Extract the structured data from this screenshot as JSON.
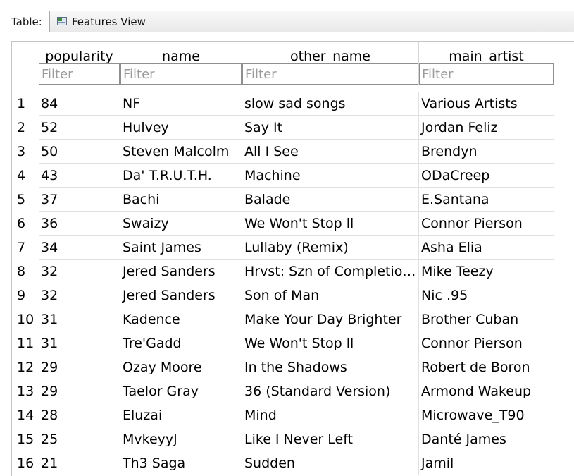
{
  "toolbar": {
    "table_label": "Table:",
    "table_select_value": "Features View",
    "table_icon": "table-icon"
  },
  "columns": [
    {
      "name": "popularity",
      "filter_placeholder": "Filter"
    },
    {
      "name": "name",
      "filter_placeholder": "Filter"
    },
    {
      "name": "other_name",
      "filter_placeholder": "Filter"
    },
    {
      "name": "main_artist",
      "filter_placeholder": "Filter"
    }
  ],
  "rows": [
    {
      "num": "1",
      "cells": [
        "84",
        "NF",
        "slow sad songs",
        "Various Artists"
      ]
    },
    {
      "num": "2",
      "cells": [
        "52",
        "Hulvey",
        "Say It",
        "Jordan Feliz"
      ]
    },
    {
      "num": "3",
      "cells": [
        "50",
        "Steven Malcolm",
        "All I See",
        "Brendyn"
      ]
    },
    {
      "num": "4",
      "cells": [
        "43",
        "Da' T.R.U.T.H.",
        "Machine",
        "ODaCreep"
      ]
    },
    {
      "num": "5",
      "cells": [
        "37",
        "Bachi",
        "Balade",
        "E.Santana"
      ]
    },
    {
      "num": "6",
      "cells": [
        "36",
        "Swaizy",
        "We Won't Stop ll",
        "Connor Pierson"
      ]
    },
    {
      "num": "7",
      "cells": [
        "34",
        "Saint James",
        "Lullaby (Remix)",
        "Asha Elia"
      ]
    },
    {
      "num": "8",
      "cells": [
        "32",
        "Jered Sanders",
        "Hrvst: Szn of Completion ...",
        "Mike Teezy"
      ]
    },
    {
      "num": "9",
      "cells": [
        "32",
        "Jered Sanders",
        "Son of Man",
        "Nic .95"
      ]
    },
    {
      "num": "10",
      "cells": [
        "31",
        "Kadence",
        "Make Your Day Brighter",
        "Brother Cuban"
      ]
    },
    {
      "num": "11",
      "cells": [
        "31",
        "Tre'Gadd",
        "We Won't Stop ll",
        "Connor Pierson"
      ]
    },
    {
      "num": "12",
      "cells": [
        "29",
        "Ozay Moore",
        "In the Shadows",
        "Robert de Boron"
      ]
    },
    {
      "num": "13",
      "cells": [
        "29",
        "Taelor Gray",
        "36 (Standard Version)",
        "Armond Wakeup"
      ]
    },
    {
      "num": "14",
      "cells": [
        "28",
        "Eluzai",
        "Mind",
        "Microwave_T90"
      ]
    },
    {
      "num": "15",
      "cells": [
        "25",
        "MvkeyyJ",
        "Like I Never Left",
        "Danté James"
      ]
    },
    {
      "num": "16",
      "cells": [
        "21",
        "Th3 Saga",
        "Sudden",
        "Jamil"
      ]
    }
  ],
  "sort": {
    "column": "popularity",
    "direction": "descending",
    "icon": "sort-descending-icon"
  }
}
